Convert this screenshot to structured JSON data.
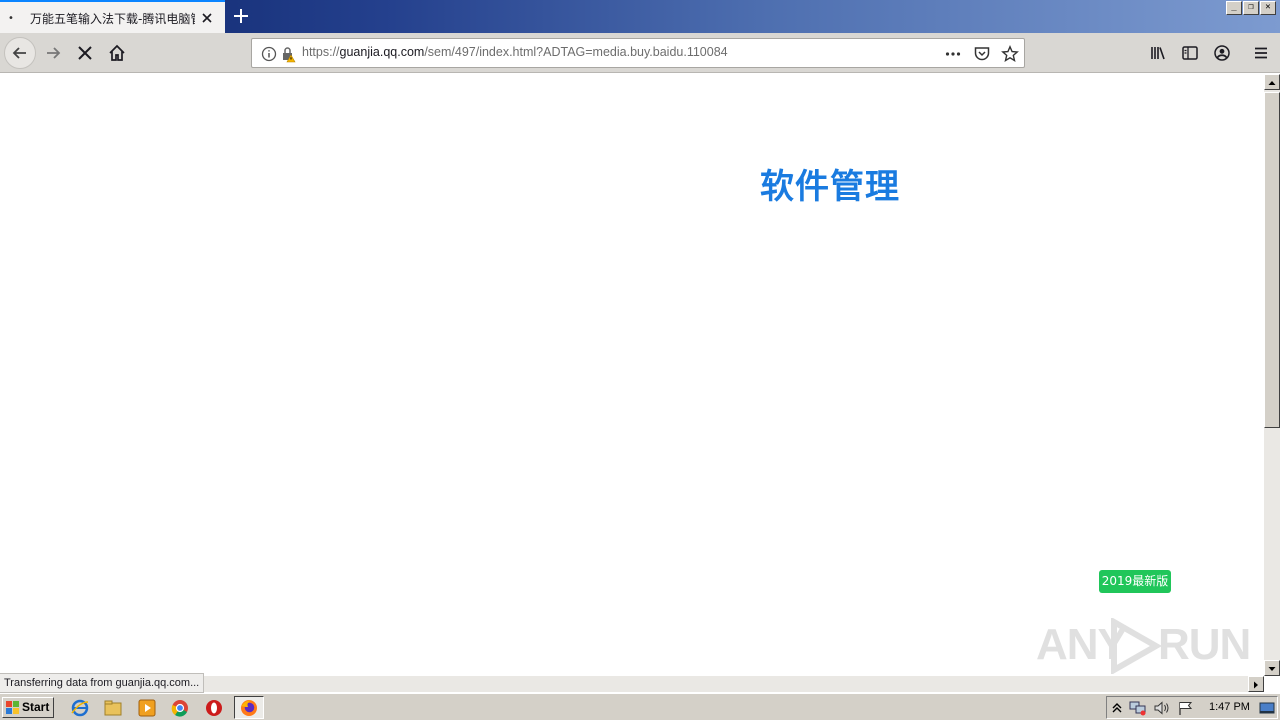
{
  "browser": {
    "tab": {
      "title": "万能五笔输入法下载-腾讯电脑管家",
      "dot": "•"
    },
    "window_buttons": {
      "minimize": "_",
      "restore": "❐",
      "close": "✕"
    },
    "url": {
      "scheme": "https://",
      "host": "guanjia.qq.com",
      "path": "/sem/497/index.html?ADTAG=media.buy.baidu.110084"
    },
    "status_text": "Transferring data from guanjia.qq.com..."
  },
  "page": {
    "headline": "软件管理",
    "badge": "2019最新版",
    "watermark": {
      "left": "ANY",
      "right": "RUN"
    }
  },
  "taskbar": {
    "start_label": "Start",
    "clock": "1:47 PM"
  },
  "colors": {
    "headline": "#1a7be0",
    "badge": "#20c65a",
    "accent": "#0a84ff"
  }
}
